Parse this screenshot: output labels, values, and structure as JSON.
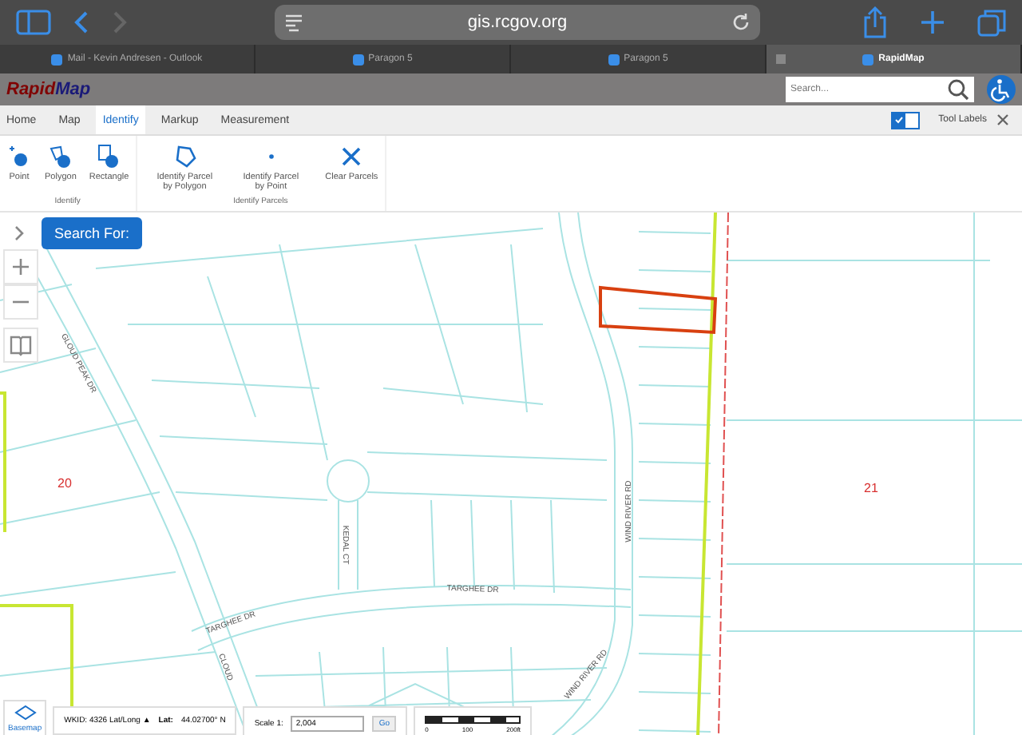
{
  "browser": {
    "url": "gis.rcgov.org",
    "tabs": [
      {
        "label": "Mail - Kevin Andresen - Outlook",
        "selected": false
      },
      {
        "label": "Paragon 5",
        "selected": false
      },
      {
        "label": "Paragon 5",
        "selected": false
      },
      {
        "label": "RapidMap",
        "selected": true
      }
    ]
  },
  "header": {
    "logo_prefix": "Rapid",
    "logo_suffix": "Map",
    "search": {
      "placeholder": "Search..."
    }
  },
  "ribbon_tabs": [
    {
      "label": "Home",
      "selected": false
    },
    {
      "label": "Map",
      "selected": false
    },
    {
      "label": "Identify",
      "selected": true
    },
    {
      "label": "Markup",
      "selected": false
    },
    {
      "label": "Measurement",
      "selected": false
    }
  ],
  "tool_labels": {
    "label": "Tool Labels",
    "checked": true
  },
  "ribbon_groups": [
    {
      "label": "Identify",
      "tools": [
        {
          "kind": "point",
          "label": "Point"
        },
        {
          "kind": "polygon",
          "label": "Polygon"
        },
        {
          "kind": "rectangle",
          "label": "Rectangle"
        }
      ]
    },
    {
      "label": "Identify Parcels",
      "tools": [
        {
          "kind": "parcel-polygon",
          "label": "Identify Parcel by Polygon"
        },
        {
          "kind": "parcel-point",
          "label": "Identify Parcel by Point"
        },
        {
          "kind": "clear",
          "label": "Clear Parcels"
        }
      ]
    }
  ],
  "search_for": "Search For:",
  "map": {
    "section_labels": [
      "20",
      "21"
    ],
    "streets": [
      {
        "label": "GLOUD PEAK DR",
        "kind": "ridge"
      },
      {
        "label": "KEDAL CT",
        "kind": "court"
      },
      {
        "label": "WIND RIVER RD",
        "kind": "wind"
      },
      {
        "label": "TARGHEE DR",
        "kind": "targhee-west"
      },
      {
        "label": "TARGHEE DR",
        "kind": "targhee-east"
      },
      {
        "label": "WIND RIVER RD",
        "kind": "wind-south"
      },
      {
        "label": "CLOUD",
        "kind": "cloud"
      }
    ]
  },
  "status_bar": {
    "basemap": "Basemap",
    "wkid": "WKID: 4326 Lat/Long ▲",
    "lat_label": "Lat:",
    "lat_value": "44.02700° N",
    "scale_label": "Scale 1:",
    "scale_value": "2,004",
    "go": "Go",
    "scale_ticks": [
      "0",
      "100",
      "200ft"
    ]
  }
}
